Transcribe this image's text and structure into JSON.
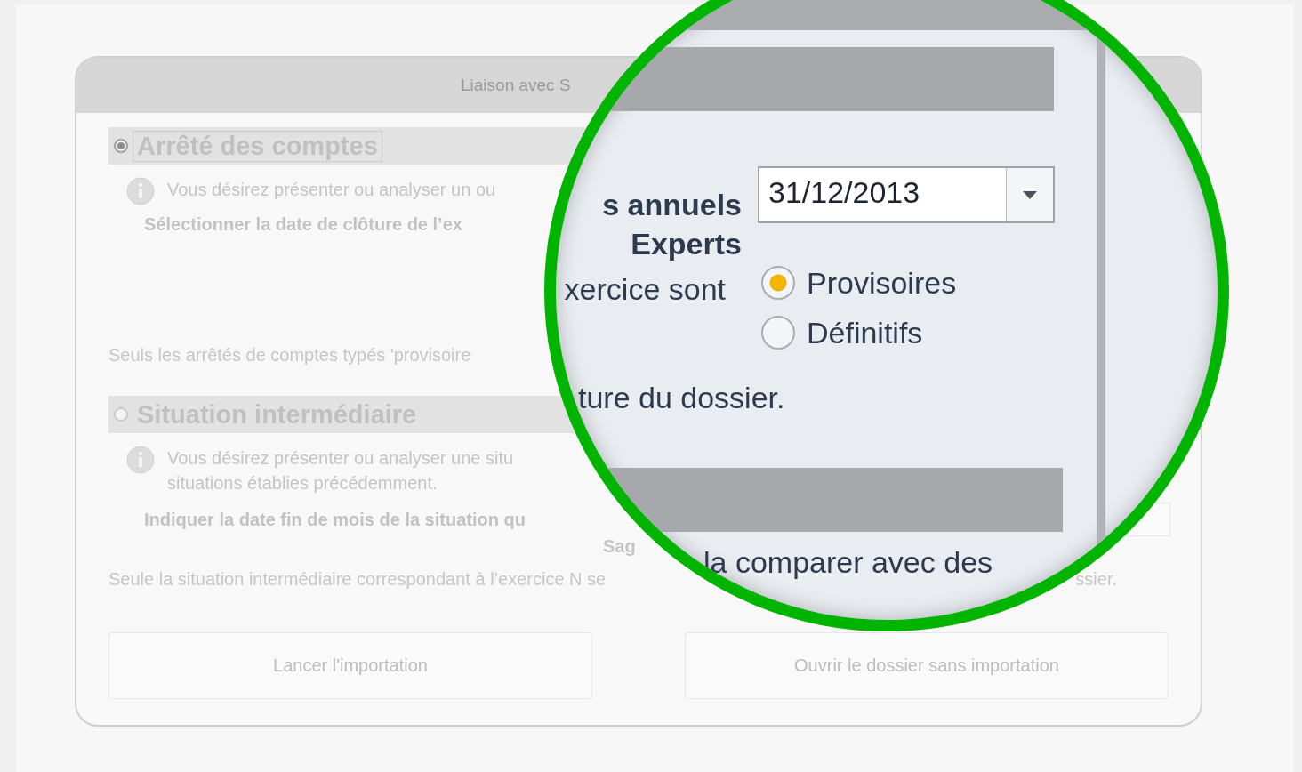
{
  "dialog": {
    "title": "Liaison avec S",
    "sections": [
      {
        "title": "Arrêté des comptes",
        "selected": true,
        "focused": true,
        "info": [
          "Vous désirez présenter ou analyser un ou"
        ],
        "prompt": "Sélectionner la date de clôture de l’ex",
        "note": "Seuls les arrêtés de comptes typés 'provisoire"
      },
      {
        "title": "Situation intermédiaire",
        "selected": false,
        "focused": false,
        "info": [
          "Vous désirez présenter ou analyser une situ",
          "situations établies précédemment."
        ],
        "prompt": "Indiquer la date fin de mois de la situation qu",
        "prompt_continued": "Sag",
        "note": "Seule la situation intermédiaire correspondant à l’exercice N se",
        "note_end": "ssier."
      }
    ],
    "buttons": [
      "Lancer l'importation",
      "Ouvrir le dossier sans importation"
    ]
  },
  "magnifier": {
    "label_lines": [
      "s annuels",
      "Experts"
    ],
    "date_value": "31/12/2013",
    "radio_label": "xercice sont",
    "radios": [
      {
        "label": "Provisoires",
        "selected": true
      },
      {
        "label": "Définitifs",
        "selected": false
      }
    ],
    "text_1": "ture du dossier.",
    "text_2": "la comparer avec des"
  }
}
